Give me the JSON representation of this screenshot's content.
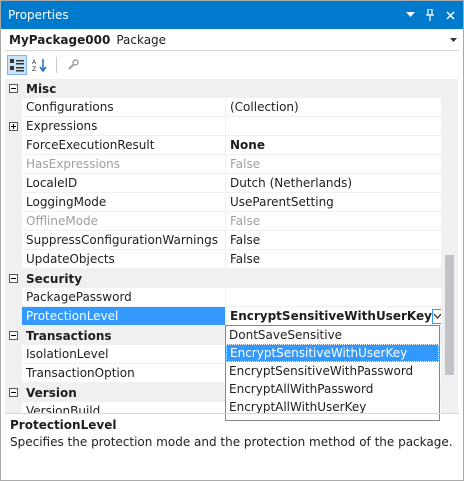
{
  "window": {
    "title": "Properties",
    "title_buttons": [
      "▾",
      "ㅍ",
      "✕"
    ]
  },
  "object_selector": {
    "name": "MyPackage000",
    "type": "Package"
  },
  "toolbar": {
    "categorized_tip": "Categorized",
    "alphabetical_tip": "Alphabetical",
    "property_pages_tip": "Property Pages"
  },
  "grid": {
    "categories": {
      "misc": "Misc",
      "security": "Security",
      "transactions": "Transactions",
      "version": "Version"
    },
    "rows": {
      "configurations": {
        "name": "Configurations",
        "value": "(Collection)"
      },
      "expressions": {
        "name": "Expressions",
        "value": ""
      },
      "force_execution_result": {
        "name": "ForceExecutionResult",
        "value": "None"
      },
      "has_expressions": {
        "name": "HasExpressions",
        "value": "False"
      },
      "locale_id": {
        "name": "LocaleID",
        "value": "Dutch (Netherlands)"
      },
      "logging_mode": {
        "name": "LoggingMode",
        "value": "UseParentSetting"
      },
      "offline_mode": {
        "name": "OfflineMode",
        "value": "False"
      },
      "suppress_config_warnings": {
        "name": "SuppressConfigurationWarnings",
        "value": "False"
      },
      "update_objects": {
        "name": "UpdateObjects",
        "value": "False"
      },
      "package_password": {
        "name": "PackagePassword",
        "value": ""
      },
      "protection_level": {
        "name": "ProtectionLevel",
        "value": "EncryptSensitiveWithUserKey"
      },
      "isolation_level": {
        "name": "IsolationLevel",
        "value": ""
      },
      "transaction_option": {
        "name": "TransactionOption",
        "value": ""
      },
      "version_build": {
        "name": "VersionBuild",
        "value": ""
      }
    }
  },
  "dropdown": {
    "options": [
      "DontSaveSensitive",
      "EncryptSensitiveWithUserKey",
      "EncryptSensitiveWithPassword",
      "EncryptAllWithPassword",
      "EncryptAllWithUserKey"
    ],
    "selected_index": 1
  },
  "description": {
    "title": "ProtectionLevel",
    "text": "Specifies the protection mode and the protection method of the package."
  },
  "colors": {
    "title_bar": "#007acc",
    "selection": "#3399ff",
    "gutter": "#f0f0f0"
  }
}
